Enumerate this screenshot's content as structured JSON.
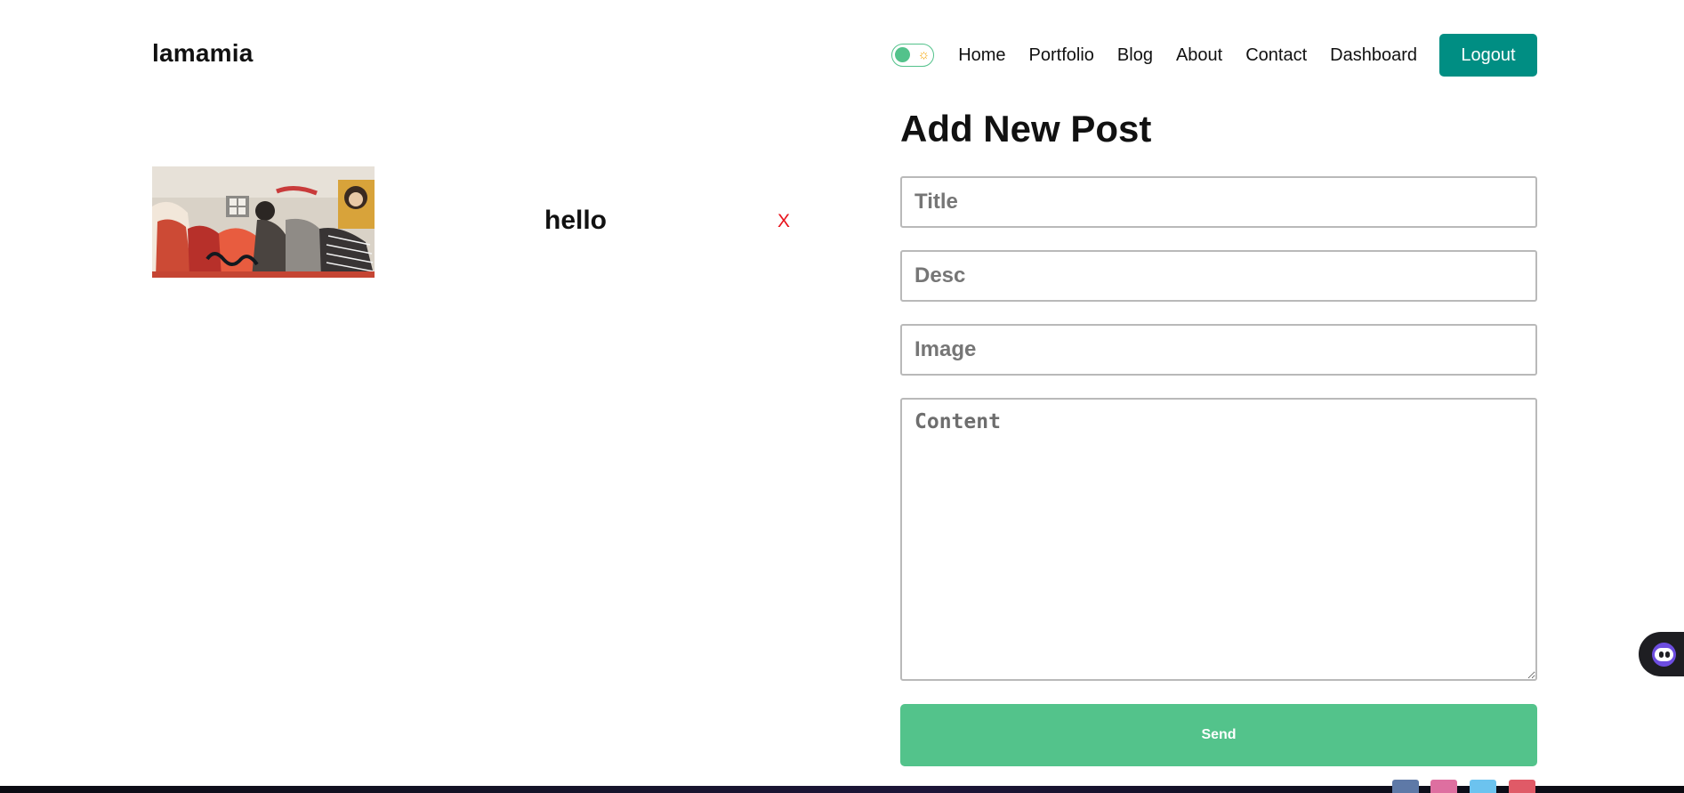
{
  "header": {
    "logo": "lamamia",
    "nav": [
      "Home",
      "Portfolio",
      "Blog",
      "About",
      "Contact",
      "Dashboard"
    ],
    "logout_label": "Logout",
    "theme_toggle_icon": "sun-icon"
  },
  "posts": [
    {
      "title": "hello",
      "delete_label": "X"
    }
  ],
  "form": {
    "heading": "Add New Post",
    "title_placeholder": "Title",
    "desc_placeholder": "Desc",
    "image_placeholder": "Image",
    "content_placeholder": "Content",
    "send_label": "Send"
  },
  "colors": {
    "accent": "#53c38b",
    "logout": "#008e83",
    "delete": "#e8141d"
  },
  "footer": {
    "social_icons": [
      "facebook-icon",
      "instagram-icon",
      "twitter-icon",
      "youtube-icon"
    ]
  }
}
